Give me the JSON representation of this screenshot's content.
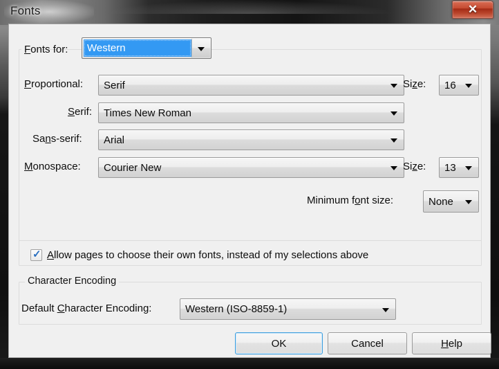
{
  "window": {
    "title": "Fonts",
    "close_label": "✕"
  },
  "fonts_group": {
    "fonts_for_label_pre": "F",
    "fonts_for_label_post": "onts for:",
    "fonts_for_value": "Western",
    "rows": [
      {
        "label_pre": "P",
        "label_post": "roportional:",
        "value": "Serif",
        "size_label_pre": "Si",
        "size_label_mid": "z",
        "size_label_post": "e:",
        "size_value": "16"
      },
      {
        "label_pre": "S",
        "label_post": "erif:",
        "value": "Times New Roman"
      },
      {
        "label_pre": "Sa",
        "label_mid": "n",
        "label_post": "s-serif:",
        "value": "Arial"
      },
      {
        "label_pre": "M",
        "label_post": "onospace:",
        "value": "Courier New",
        "size_label_pre": "Si",
        "size_label_mid": "z",
        "size_label_post": "e:",
        "size_value": "13"
      }
    ],
    "minimum_font_size_pre": "Minimum f",
    "minimum_font_size_mid": "o",
    "minimum_font_size_post": "nt size:",
    "minimum_font_size_value": "None",
    "allow_pages_checked": true,
    "allow_pages_tick": "✓",
    "allow_pages_label_pre": "A",
    "allow_pages_label_post": "llow pages to choose their own fonts, instead of my selections above"
  },
  "character_encoding_group": {
    "legend": "Character Encoding",
    "label_pre": "Default ",
    "label_mid": "C",
    "label_post": "haracter Encoding:",
    "value": "Western (ISO-8859-1)"
  },
  "buttons": {
    "ok": "OK",
    "cancel": "Cancel",
    "help_pre": "",
    "help_mid": "H",
    "help_post": "elp"
  },
  "colors": {
    "accent_selection": "#3399f3",
    "default_button_border": "#3c9ddd",
    "dialog_bg": "#f0f0f0",
    "close_button_red": "#c64b31",
    "check_blue": "#2a6fc0"
  }
}
